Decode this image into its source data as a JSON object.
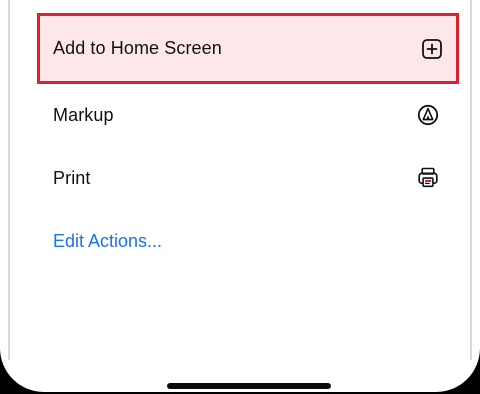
{
  "actions": [
    {
      "label": "Add to Home Screen",
      "icon": "plus-square-icon",
      "highlighted": true,
      "highlight_color": "#d8232f"
    },
    {
      "label": "Markup",
      "icon": "markup-pen-icon"
    },
    {
      "label": "Print",
      "icon": "printer-icon"
    }
  ],
  "edit_actions": {
    "label": "Edit Actions...",
    "color": "#1a73e8"
  }
}
